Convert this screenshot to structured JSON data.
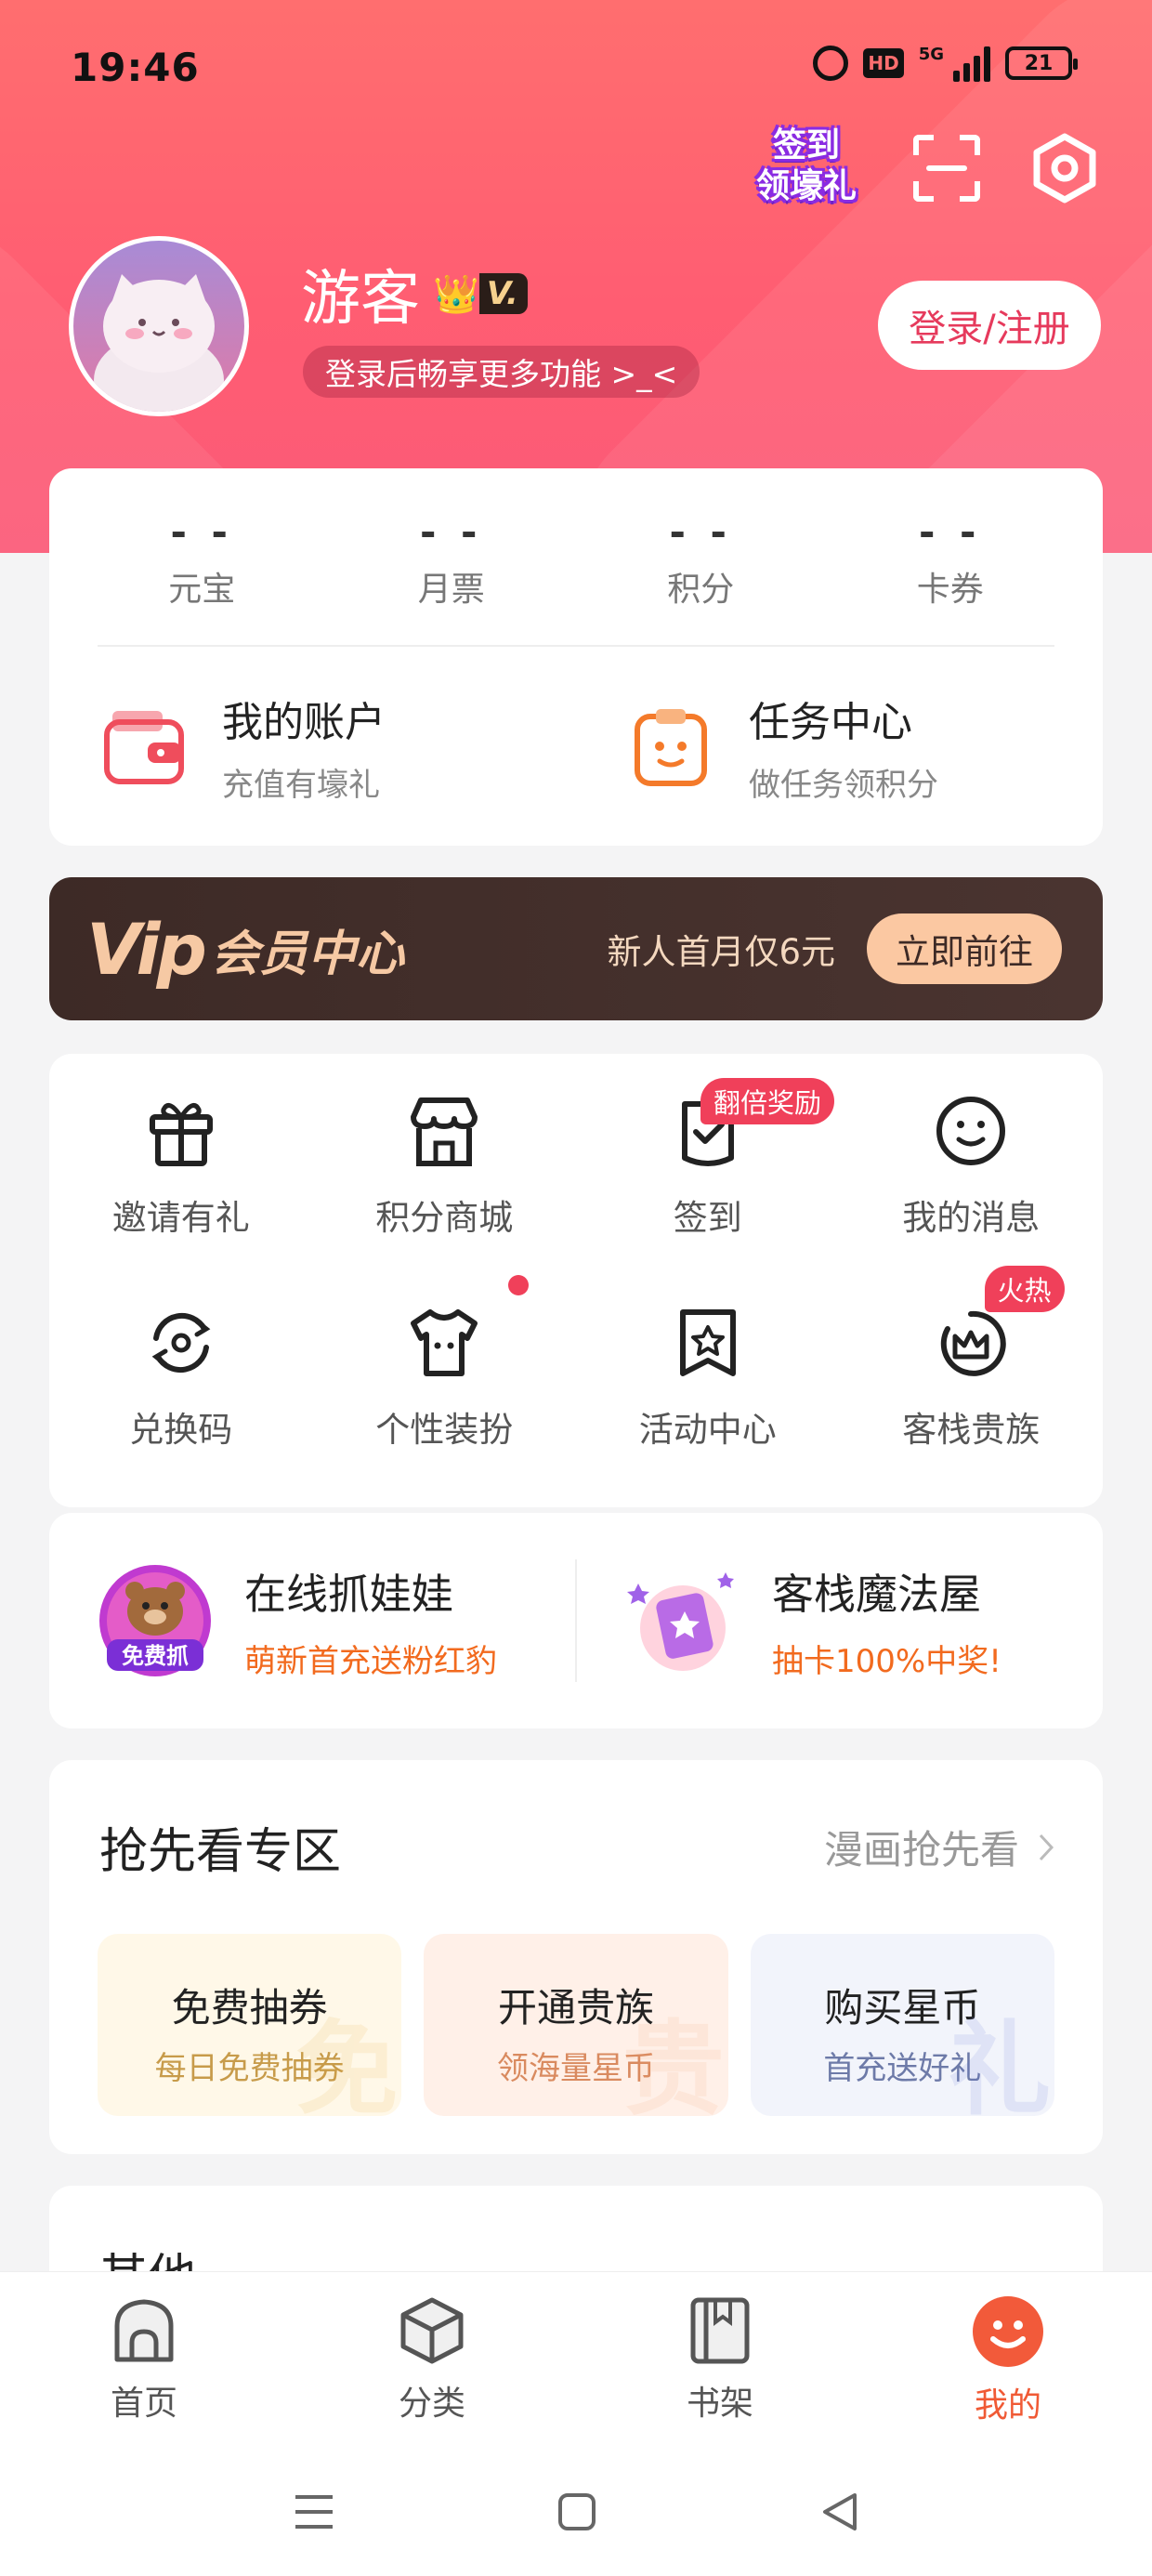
{
  "status_bar": {
    "time": "19:46",
    "hd": "HD",
    "network": "5G",
    "battery": "21"
  },
  "header": {
    "signin_badge": [
      "签到",
      "领壕礼"
    ],
    "username": "游客",
    "vip_tag": "V.",
    "login_tip": "登录后畅享更多功能 >_<",
    "login_button": "登录/注册"
  },
  "stats": [
    {
      "value": "- -",
      "label": "元宝"
    },
    {
      "value": "- -",
      "label": "月票"
    },
    {
      "value": "- -",
      "label": "积分"
    },
    {
      "value": "- -",
      "label": "卡券"
    }
  ],
  "accounts": [
    {
      "title": "我的账户",
      "subtitle": "充值有壕礼",
      "icon": "wallet-icon"
    },
    {
      "title": "任务中心",
      "subtitle": "做任务领积分",
      "icon": "task-icon"
    }
  ],
  "vip_banner": {
    "logo_mark": "Vip",
    "title": "会员中心",
    "promo": "新人首月仅6元",
    "button": "立即前往"
  },
  "grid": [
    {
      "label": "邀请有礼",
      "icon": "gift-icon"
    },
    {
      "label": "积分商城",
      "icon": "store-icon"
    },
    {
      "label": "签到",
      "icon": "checkin-icon",
      "badge": "翻倍奖励"
    },
    {
      "label": "我的消息",
      "icon": "smile-message-icon"
    },
    {
      "label": "兑换码",
      "icon": "redeem-code-icon"
    },
    {
      "label": "个性装扮",
      "icon": "tshirt-icon",
      "dot": true
    },
    {
      "label": "活动中心",
      "icon": "star-bookmark-icon"
    },
    {
      "label": "客栈贵族",
      "icon": "crown-icon",
      "badge": "火热"
    }
  ],
  "promos": [
    {
      "title": "在线抓娃娃",
      "subtitle": "萌新首充送粉红豹",
      "image_label": "免费抓"
    },
    {
      "title": "客栈魔法屋",
      "subtitle": "抽卡100%中奖!"
    }
  ],
  "preview": {
    "title": "抢先看专区",
    "more": "漫画抢先看",
    "tiles": [
      {
        "title": "免费抽券",
        "subtitle": "每日免费抽券",
        "ghost": "免",
        "bg": "#fff8e8",
        "sub_color": "#c79b4a"
      },
      {
        "title": "开通贵族",
        "subtitle": "领海量星币",
        "ghost": "贵",
        "bg": "#fff0e8",
        "sub_color": "#d98a5f"
      },
      {
        "title": "购买星币",
        "subtitle": "首充送好礼",
        "ghost": "礼",
        "bg": "#f2f4fb",
        "sub_color": "#6d7aa8"
      }
    ]
  },
  "other": {
    "title": "其他"
  },
  "tabbar": [
    {
      "label": "首页",
      "icon": "home-icon"
    },
    {
      "label": "分类",
      "icon": "category-cube-icon"
    },
    {
      "label": "书架",
      "icon": "bookshelf-icon"
    },
    {
      "label": "我的",
      "icon": "profile-smile-icon",
      "active": true
    }
  ],
  "colors": {
    "header": "#ff6470",
    "accent": "#f05a35",
    "badge": "#f0405a",
    "vip_dark": "#3d2a26"
  }
}
